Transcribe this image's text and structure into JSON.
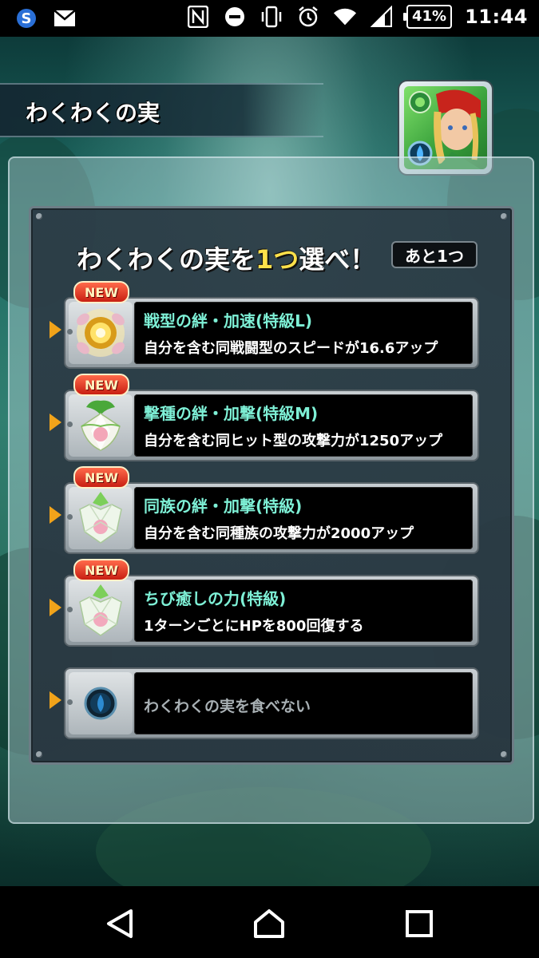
{
  "status_bar": {
    "time": "11:44",
    "battery_percent": "41%",
    "left_icons": [
      "s-app-icon",
      "mail-icon"
    ],
    "right_icons": [
      "nfc-icon",
      "dnd-icon",
      "vibrate-icon",
      "alarm-icon",
      "wifi-icon",
      "signal-icon"
    ]
  },
  "screen": {
    "title": "わくわくの実",
    "heading_prefix": "わくわくの実を",
    "heading_highlight": "1つ",
    "heading_suffix": "選べ！",
    "remaining": "あと1つ",
    "new_badge": "NEW",
    "options": [
      {
        "name": "戦型の絆・加速(特級L)",
        "desc": "自分を含む同戦闘型のスピードが16.6アップ",
        "icon": "golden-fruit-icon",
        "is_new": true
      },
      {
        "name": "撃種の絆・加撃(特級M)",
        "desc": "自分を含む同ヒット型の攻撃力が1250アップ",
        "icon": "leaf-fruit-icon",
        "is_new": true
      },
      {
        "name": "同族の絆・加撃(特級)",
        "desc": "自分を含む同種族の攻撃力が2000アップ",
        "icon": "crystal-fruit-icon",
        "is_new": true
      },
      {
        "name": "ちび癒しの力(特級)",
        "desc": "1ターンごとにHPを800回復する",
        "icon": "crystal-fruit-icon",
        "is_new": true
      }
    ],
    "skip_option": {
      "label": "わくわくの実を食べない",
      "icon": "blue-orb-icon"
    }
  },
  "nav": {
    "back_icon": "back-triangle-icon",
    "home_icon": "home-icon",
    "recents_icon": "recents-square-icon"
  },
  "colors": {
    "name_text": "#7ef0d6",
    "highlight": "#ffe14a",
    "arrow": "#f1a31a",
    "new_badge": "#e0331f"
  }
}
